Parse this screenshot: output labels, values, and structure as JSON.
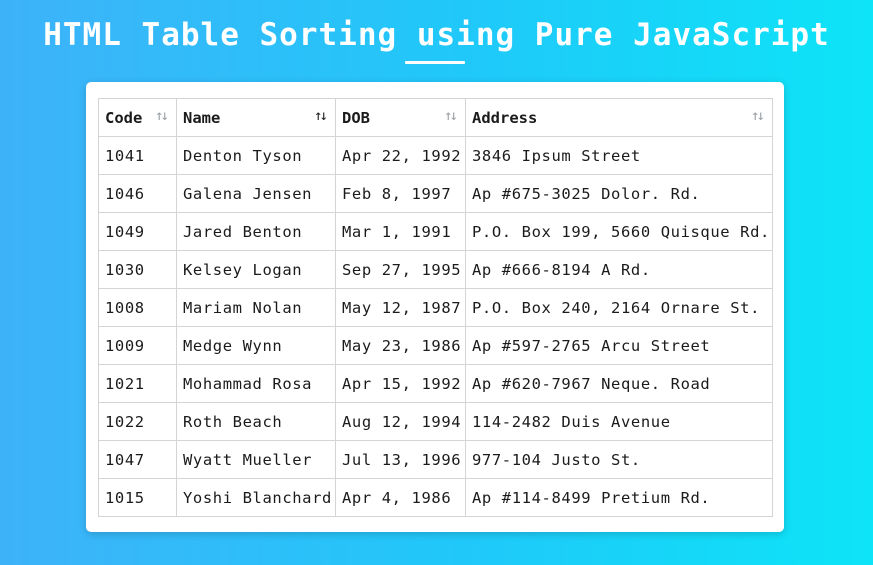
{
  "page": {
    "title": "HTML Table Sorting using Pure JavaScript"
  },
  "table": {
    "columns": [
      {
        "label": "Code",
        "icon": "sort-arrows-icon",
        "active": false
      },
      {
        "label": "Name",
        "icon": "sort-arrows-icon",
        "active": true
      },
      {
        "label": "DOB",
        "icon": "sort-arrows-icon",
        "active": false
      },
      {
        "label": "Address",
        "icon": "sort-arrows-icon",
        "active": false
      }
    ],
    "sort_glyph": "↑↓",
    "rows": [
      [
        "1041",
        "Denton Tyson",
        "Apr 22, 1992",
        "3846 Ipsum Street"
      ],
      [
        "1046",
        "Galena Jensen",
        "Feb 8, 1997",
        "Ap #675-3025 Dolor. Rd."
      ],
      [
        "1049",
        "Jared Benton",
        "Mar 1, 1991",
        "P.O. Box 199, 5660 Quisque Rd."
      ],
      [
        "1030",
        "Kelsey Logan",
        "Sep 27, 1995",
        "Ap #666-8194 A Rd."
      ],
      [
        "1008",
        "Mariam Nolan",
        "May 12, 1987",
        "P.O. Box 240, 2164 Ornare St."
      ],
      [
        "1009",
        "Medge Wynn",
        "May 23, 1986",
        "Ap #597-2765 Arcu Street"
      ],
      [
        "1021",
        "Mohammad Rosa",
        "Apr 15, 1992",
        "Ap #620-7967 Neque. Road"
      ],
      [
        "1022",
        "Roth Beach",
        "Aug 12, 1994",
        "114-2482 Duis Avenue"
      ],
      [
        "1047",
        "Wyatt Mueller",
        "Jul 13, 1996",
        "977-104 Justo St."
      ],
      [
        "1015",
        "Yoshi Blanchard",
        "Apr 4, 1986",
        "Ap #114-8499 Pretium Rd."
      ]
    ]
  },
  "colors": {
    "background_start": "#3eb2f9",
    "background_end": "#0de4f7",
    "card": "#ffffff",
    "border": "#d4d4d4",
    "text": "#1b1b1b",
    "inactive_icon": "#9aa0a6"
  }
}
